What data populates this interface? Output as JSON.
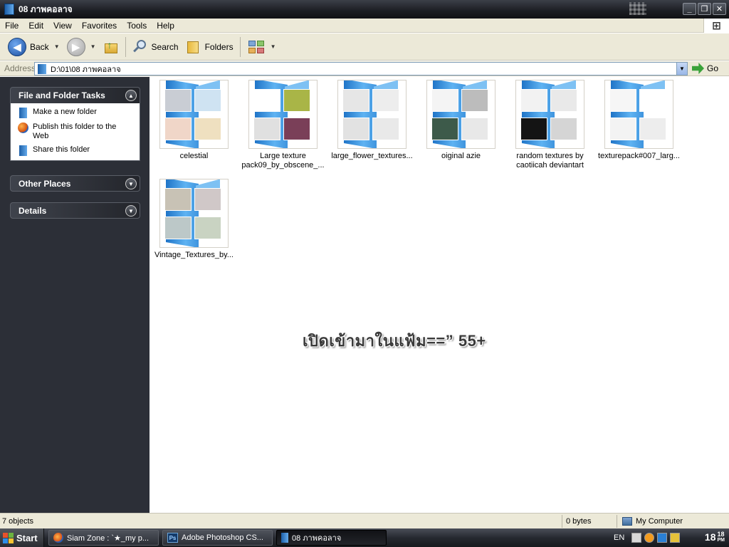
{
  "window": {
    "title": "08 ภาพคอลาจ"
  },
  "menu": [
    "File",
    "Edit",
    "View",
    "Favorites",
    "Tools",
    "Help"
  ],
  "toolbar": {
    "back_label": "Back",
    "search_label": "Search",
    "folders_label": "Folders"
  },
  "address": {
    "label": "Address",
    "path": "D:\\01\\08 ภาพคอลาจ",
    "go_label": "Go"
  },
  "tasks": {
    "file_folder_title": "File and Folder Tasks",
    "links": [
      {
        "label": "Make a new folder",
        "icon": "new-folder-icon"
      },
      {
        "label": "Publish this folder to the Web",
        "icon": "web-publish-icon"
      },
      {
        "label": "Share this folder",
        "icon": "share-folder-icon"
      }
    ],
    "other_places_title": "Other Places",
    "details_title": "Details"
  },
  "files": [
    {
      "name": "celestial",
      "colors": [
        "#c9cdd4",
        "#cfe3f2",
        "#f0d6c8",
        "#efe0c0"
      ]
    },
    {
      "name": "Large texture pack09_by_obscene_...",
      "colors": [
        "#ffffff",
        "#a9b547",
        "#e0e0e0",
        "#7a3f58"
      ]
    },
    {
      "name": "large_flower_textures...",
      "colors": [
        "#e6e6e6",
        "#ededed",
        "#e2e2e2",
        "#e9e9e9"
      ]
    },
    {
      "name": "oiginal azie",
      "colors": [
        "#f4f4f4",
        "#bcbcbc",
        "#3d5a4a",
        "#e8e8e8"
      ]
    },
    {
      "name": "random textures by caotiicah deviantart",
      "colors": [
        "#f2f2f2",
        "#e9e9e9",
        "#141414",
        "#d5d5d5"
      ]
    },
    {
      "name": "texturepack#007_larg...",
      "colors": [
        "#f6f6f6",
        "#ffffff",
        "#f3f3f3",
        "#ededed"
      ]
    },
    {
      "name": "Vintage_Textures_by...",
      "colors": [
        "#c8c2b5",
        "#d0c8c8",
        "#bcc8c8",
        "#c9d3c2"
      ]
    }
  ],
  "overlay_text": "เปิดเข้ามาในแฟ้ม==” 55+",
  "status": {
    "objects": "7 objects",
    "size": "0 bytes",
    "location": "My Computer"
  },
  "taskbar": {
    "start_label": "Start",
    "items": [
      {
        "label": "Siam Zone : `★_my p...",
        "icon": "firefox-icon"
      },
      {
        "label": "Adobe Photoshop CS...",
        "icon": "photoshop-icon"
      },
      {
        "label": "08 ภาพคอลาจ",
        "icon": "folder-icon"
      }
    ],
    "lang": "EN",
    "clock_hour": "18",
    "clock_min": "18",
    "clock_ampm": "PM"
  }
}
